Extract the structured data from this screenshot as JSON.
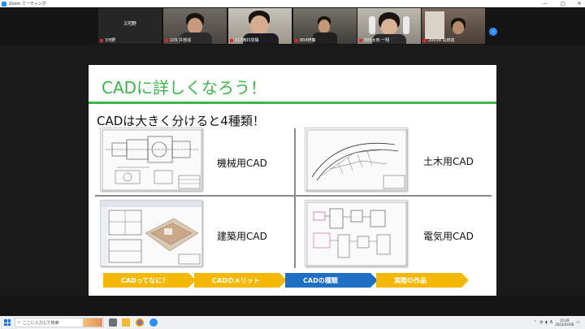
{
  "window": {
    "title": "Zoom ミーティング",
    "controls": [
      "—",
      "□",
      "✕"
    ]
  },
  "participants": [
    {
      "label": "3河野",
      "type": "blank",
      "big_label": "3河野"
    },
    {
      "label": "105 井部成",
      "type": "video"
    },
    {
      "label": "117西村泉陽",
      "type": "video"
    },
    {
      "label": "804伊藤",
      "type": "video"
    },
    {
      "label": "305太田 一翔",
      "type": "video"
    },
    {
      "label": "20034 山田達",
      "type": "video"
    }
  ],
  "slide": {
    "title": "CADに詳しくなろう！",
    "subtitle": "CADは大きく分けると4種類！",
    "categories": [
      "機械用CAD",
      "土木用CAD",
      "建築用CAD",
      "電気用CAD"
    ],
    "breadcrumbs": [
      "CADってなに？",
      "CADのメリット",
      "CADの種類",
      "実際の作品"
    ],
    "crumb_colors": [
      "#f5b800",
      "#f5b800",
      "#1f6fc4",
      "#f5b800"
    ]
  },
  "taskbar": {
    "search_placeholder": "ここに入力して検索",
    "ime": "A",
    "time": "15:49",
    "date": "2023/02/08"
  }
}
